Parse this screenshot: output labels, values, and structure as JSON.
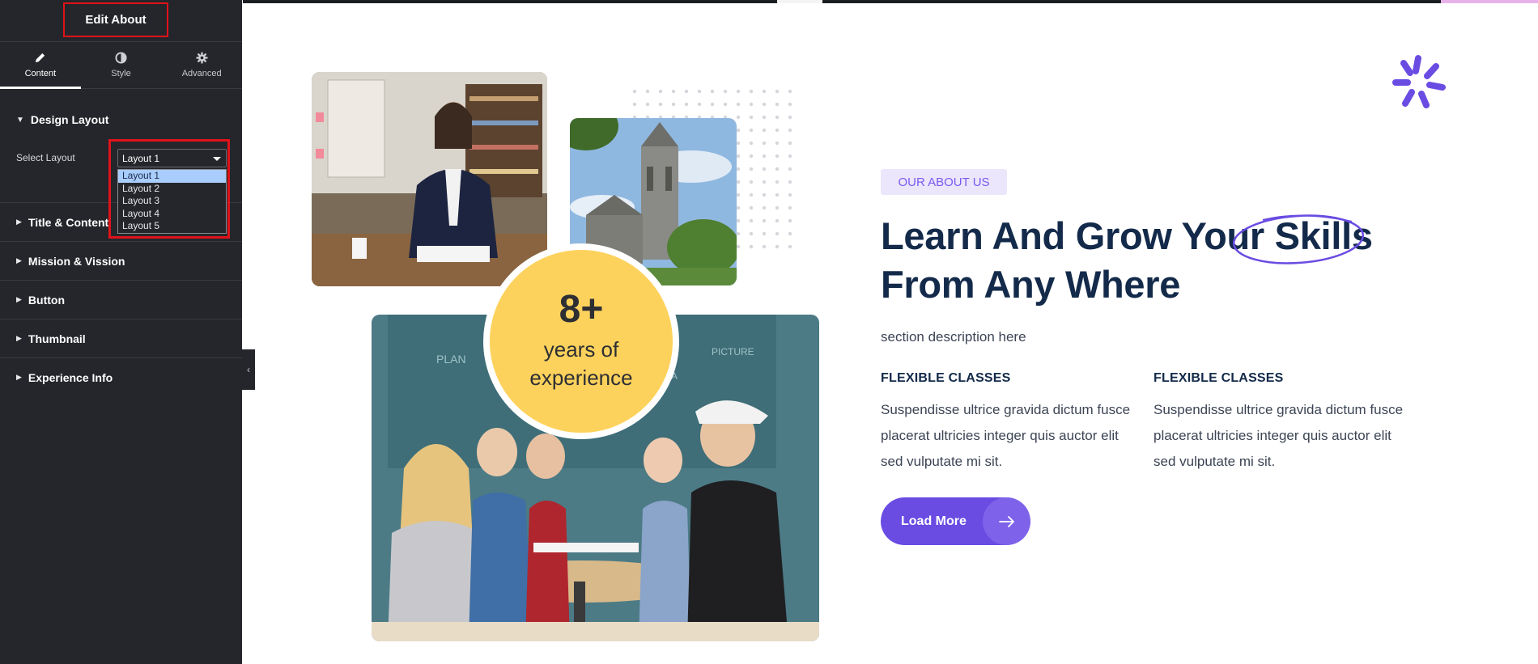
{
  "sidebar": {
    "title": "Edit About",
    "tabs": [
      {
        "label": "Content",
        "icon": "pencil-icon"
      },
      {
        "label": "Style",
        "icon": "half-circle-icon"
      },
      {
        "label": "Advanced",
        "icon": "gear-icon"
      }
    ],
    "design_layout": {
      "label": "Design Layout",
      "select_label": "Select Layout",
      "selected": "Layout 1",
      "options": [
        "Layout 1",
        "Layout 2",
        "Layout 3",
        "Layout 4",
        "Layout 5"
      ]
    },
    "sections": [
      "Title & Content",
      "Mission & Vission",
      "Button",
      "Thumbnail",
      "Experience Info"
    ]
  },
  "about": {
    "tag": "OUR ABOUT US",
    "heading_line1": "Learn And Grow Your Skills",
    "heading_line2": "From Any Where",
    "description": "section description here",
    "features": [
      {
        "title": "FLEXIBLE CLASSES",
        "text": "Suspendisse ultrice gravida dictum fusce placerat ultricies integer quis auctor elit sed vulputate mi sit."
      },
      {
        "title": "FLEXIBLE CLASSES",
        "text": "Suspendisse ultrice gravida dictum fusce placerat ultricies integer quis auctor elit sed vulputate mi sit."
      }
    ],
    "button_label": "Load More",
    "experience_number": "8+",
    "experience_line1": "years of",
    "experience_line2": "experience"
  },
  "colors": {
    "accent": "#6a4ce3",
    "badge": "#fdd25c",
    "heading": "#132a4a",
    "sidebar_bg": "#25262b",
    "highlight": "#e0121a"
  }
}
